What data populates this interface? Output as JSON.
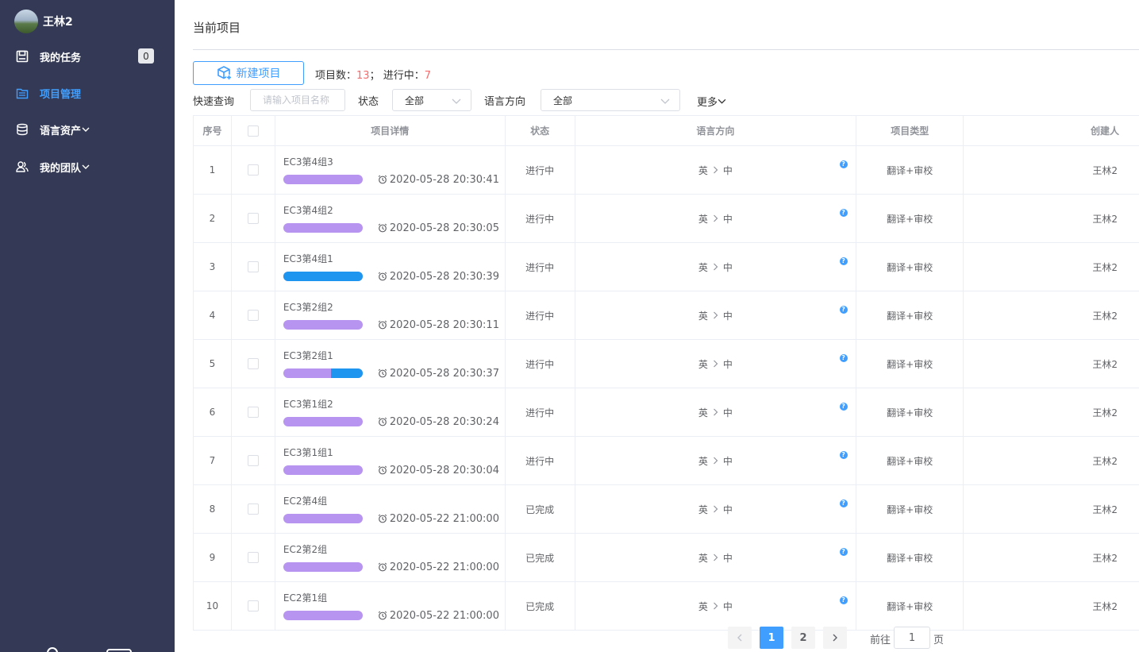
{
  "sidebar": {
    "user_name": "王林2",
    "items": [
      {
        "label": "我的任务",
        "badge": "0"
      },
      {
        "label": "项目管理"
      },
      {
        "label": "语言资产"
      },
      {
        "label": "我的团队"
      }
    ]
  },
  "header": {
    "title": "当前项目"
  },
  "toolbar": {
    "new_project_label": "新建项目",
    "count_label": "项目数：",
    "count_value": "13",
    "count_sep": "；",
    "running_label": "进行中：",
    "running_value": "7"
  },
  "filters": {
    "quick_search_label": "快速查询",
    "search_placeholder": "请输入项目名称",
    "status_label": "状态",
    "status_value": "全部",
    "lang_label": "语言方向",
    "lang_value": "全部",
    "more_label": "更多"
  },
  "table": {
    "headers": [
      "序号",
      "",
      "项目详情",
      "状态",
      "语言方向",
      "项目类型",
      "创建人"
    ],
    "rows": [
      {
        "no": "1",
        "name": "EC3第4组3",
        "time": "2020-05-28 20:30:41",
        "status": "进行中",
        "src": "英",
        "tgt": "中",
        "type": "翻译+审校",
        "creator": "王林2",
        "progress_blue": 0
      },
      {
        "no": "2",
        "name": "EC3第4组2",
        "time": "2020-05-28 20:30:05",
        "status": "进行中",
        "src": "英",
        "tgt": "中",
        "type": "翻译+审校",
        "creator": "王林2",
        "progress_blue": 0
      },
      {
        "no": "3",
        "name": "EC3第4组1",
        "time": "2020-05-28 20:30:39",
        "status": "进行中",
        "src": "英",
        "tgt": "中",
        "type": "翻译+审校",
        "creator": "王林2",
        "progress_blue": 1
      },
      {
        "no": "4",
        "name": "EC3第2组2",
        "time": "2020-05-28 20:30:11",
        "status": "进行中",
        "src": "英",
        "tgt": "中",
        "type": "翻译+审校",
        "creator": "王林2",
        "progress_blue": 0
      },
      {
        "no": "5",
        "name": "EC3第2组1",
        "time": "2020-05-28 20:30:37",
        "status": "进行中",
        "src": "英",
        "tgt": "中",
        "type": "翻译+审校",
        "creator": "王林2",
        "progress_blue": 0.4
      },
      {
        "no": "6",
        "name": "EC3第1组2",
        "time": "2020-05-28 20:30:24",
        "status": "进行中",
        "src": "英",
        "tgt": "中",
        "type": "翻译+审校",
        "creator": "王林2",
        "progress_blue": 0
      },
      {
        "no": "7",
        "name": "EC3第1组1",
        "time": "2020-05-28 20:30:04",
        "status": "进行中",
        "src": "英",
        "tgt": "中",
        "type": "翻译+审校",
        "creator": "王林2",
        "progress_blue": 0
      },
      {
        "no": "8",
        "name": "EC2第4组",
        "time": "2020-05-22 21:00:00",
        "status": "已完成",
        "src": "英",
        "tgt": "中",
        "type": "翻译+审校",
        "creator": "王林2",
        "progress_blue": 0
      },
      {
        "no": "9",
        "name": "EC2第2组",
        "time": "2020-05-22 21:00:00",
        "status": "已完成",
        "src": "英",
        "tgt": "中",
        "type": "翻译+审校",
        "creator": "王林2",
        "progress_blue": 0
      },
      {
        "no": "10",
        "name": "EC2第1组",
        "time": "2020-05-22 21:00:00",
        "status": "已完成",
        "src": "英",
        "tgt": "中",
        "type": "翻译+审校",
        "creator": "王林2",
        "progress_blue": 0
      }
    ]
  },
  "pagination": {
    "pages": [
      "1",
      "2"
    ],
    "current": "1",
    "goto_label": "前往",
    "goto_value": "1",
    "page_suffix": "页"
  },
  "colors": {
    "sidebar_bg": "#343a56",
    "accent": "#409eff",
    "count_red": "#f56c6c",
    "bar_purple": "#b794f0",
    "bar_blue": "#1e96f0"
  }
}
